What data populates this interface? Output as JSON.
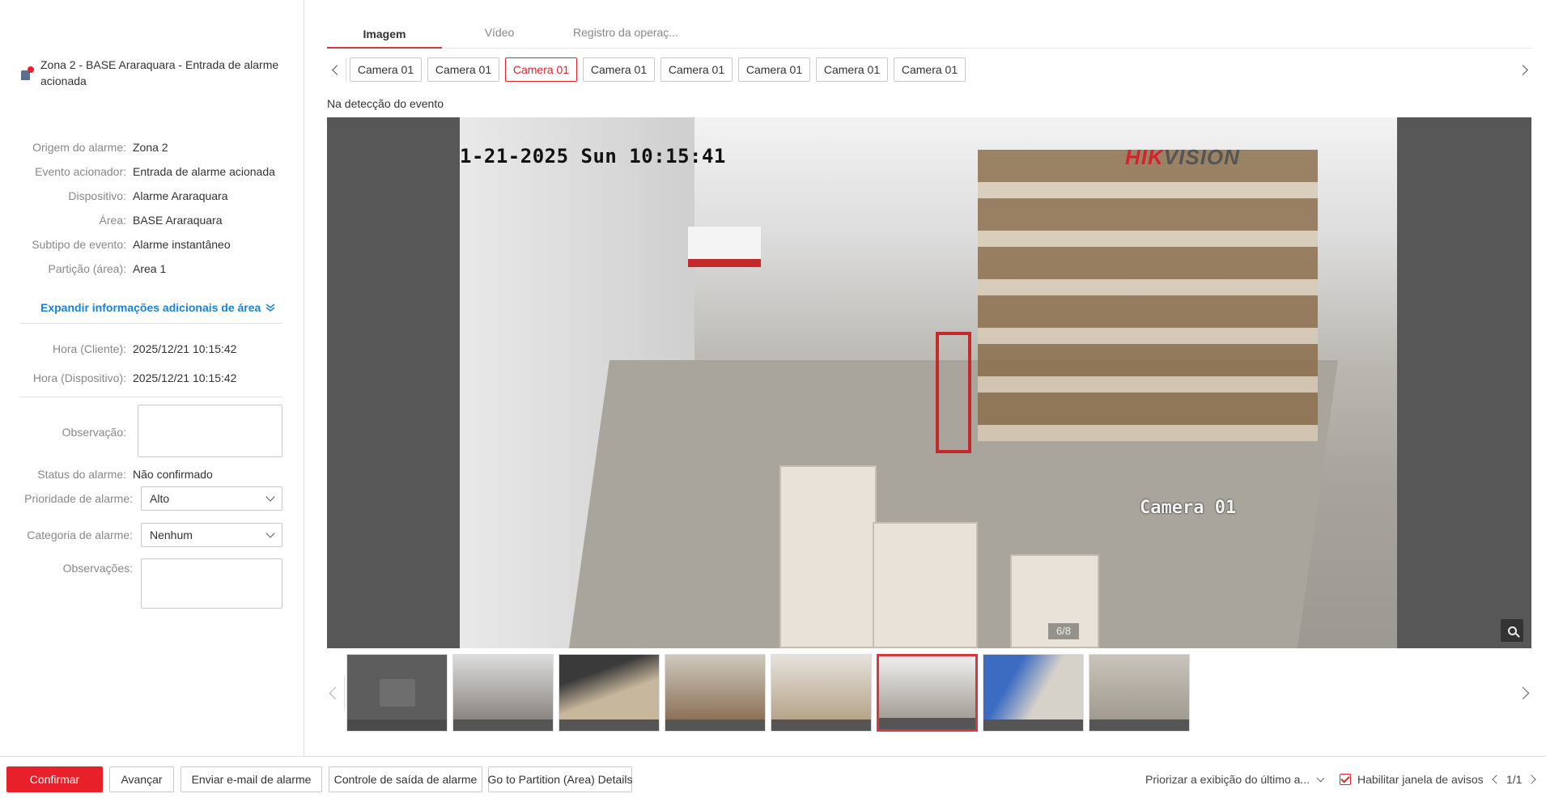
{
  "event": {
    "title": "Zona 2 - BASE Araraquara - Entrada de alarme acionada",
    "icon": "alarm-device-icon"
  },
  "details": [
    {
      "label": "Origem do alarme:",
      "value": "Zona 2"
    },
    {
      "label": "Evento acionador:",
      "value": "Entrada de alarme acionada"
    },
    {
      "label": "Dispositivo:",
      "value": "Alarme Araraquara"
    },
    {
      "label": "Área:",
      "value": "BASE Araraquara"
    },
    {
      "label": "Subtipo de evento:",
      "value": "Alarme instantâneo"
    },
    {
      "label": "Partição (área):",
      "value": "Area 1"
    }
  ],
  "expand_label": "Expandir informações adicionais de área",
  "times": [
    {
      "label": "Hora (Cliente):",
      "value": "2025/12/21 10:15:42"
    },
    {
      "label": "Hora (Dispositivo):",
      "value": "2025/12/21 10:15:42"
    }
  ],
  "form": {
    "observation_label": "Observação:",
    "observation_value": "",
    "status_label": "Status do alarme:",
    "status_value": "Não confirmado",
    "priority_label": "Prioridade de alarme:",
    "priority_value": "Alto",
    "category_label": "Categoria de alarme:",
    "category_value": "Nenhum",
    "remarks_label": "Observações:",
    "remarks_value": ""
  },
  "tabs": [
    "Imagem",
    "Vídeo",
    "Registro da operaç..."
  ],
  "active_tab": 0,
  "cameras": [
    "Camera 01",
    "Camera 01",
    "Camera 01",
    "Camera 01",
    "Camera 01",
    "Camera 01",
    "Camera 01",
    "Camera 01"
  ],
  "active_camera": 2,
  "detect_label": "Na detecção do evento",
  "image": {
    "osd_time": "1-21-2025 Sun 10:15:41",
    "osd_camera": "Camera 01",
    "brand_a": "HIK",
    "brand_b": "VISION",
    "counter": "6/8"
  },
  "thumbnails_active": 5,
  "footer": {
    "confirm": "Confirmar",
    "next": "Avançar",
    "email": "Enviar e-mail de alarme",
    "output": "Controle de saída de alarme",
    "partition": "Go to Partition (Area) Details",
    "priority_display": "Priorizar a exibição do último a...",
    "enable_popup": "Habilitar janela de avisos",
    "page": "1/1"
  },
  "colors": {
    "accent": "#e8202a",
    "link": "#1a82d8"
  }
}
